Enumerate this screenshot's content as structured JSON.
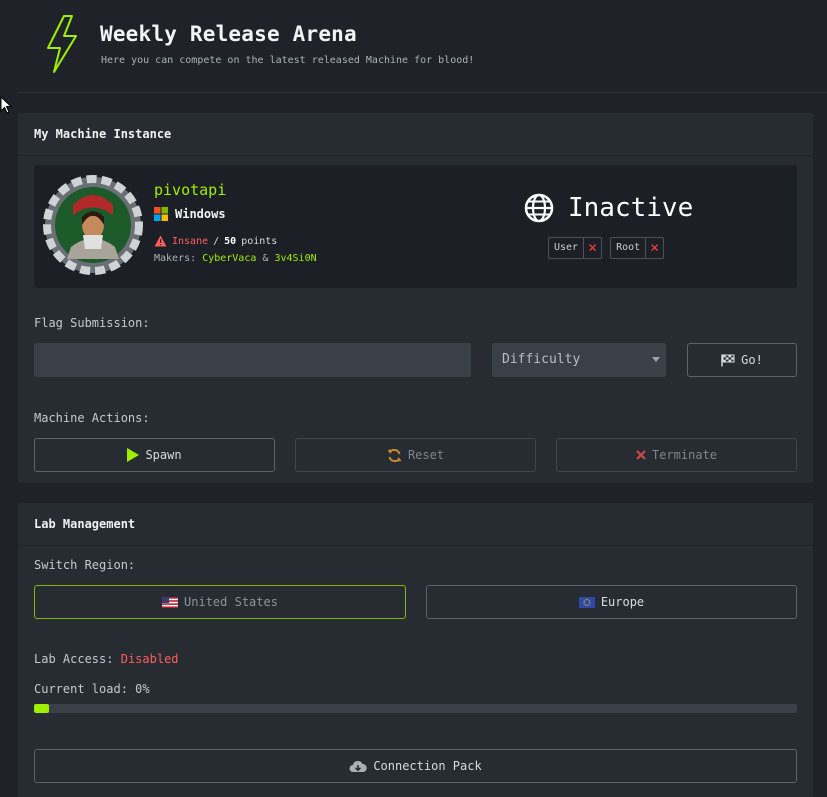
{
  "header": {
    "title": "Weekly Release Arena",
    "subtitle": "Here you can compete on the latest released Machine for blood!"
  },
  "machine_panel": {
    "title": "My Machine Instance",
    "machine": {
      "name": "pivotapi",
      "os": "Windows",
      "difficulty": "Insane",
      "separator": "/",
      "points_value": "50",
      "points_label": "points",
      "makers_label": "Makers:",
      "maker_1": "CyberVaca",
      "maker_and": "&",
      "maker_2": "3v4Si0N"
    },
    "status": "Inactive",
    "flags": [
      {
        "label": "User",
        "mark": "✕"
      },
      {
        "label": "Root",
        "mark": "✕"
      }
    ],
    "flag_submission_label": "Flag Submission:",
    "flag_input_placeholder": "",
    "difficulty_select": "Difficulty",
    "go_button": "Go!",
    "machine_actions_label": "Machine Actions:",
    "spawn_button": "Spawn",
    "reset_button": "Reset",
    "terminate_button": "Terminate"
  },
  "lab_panel": {
    "title": "Lab Management",
    "switch_region_label": "Switch Region:",
    "region_us": "United States",
    "region_eu": "Europe",
    "lab_access_label": "Lab Access:",
    "lab_access_value": "Disabled",
    "current_load_label": "Current load:",
    "current_load_value": "0%",
    "load_fraction": 0.02,
    "connection_pack_button": "Connection Pack"
  },
  "colors": {
    "accent": "#9fef00",
    "danger": "#ff5d5d",
    "background": "#1f2329",
    "panel": "#272c32"
  }
}
